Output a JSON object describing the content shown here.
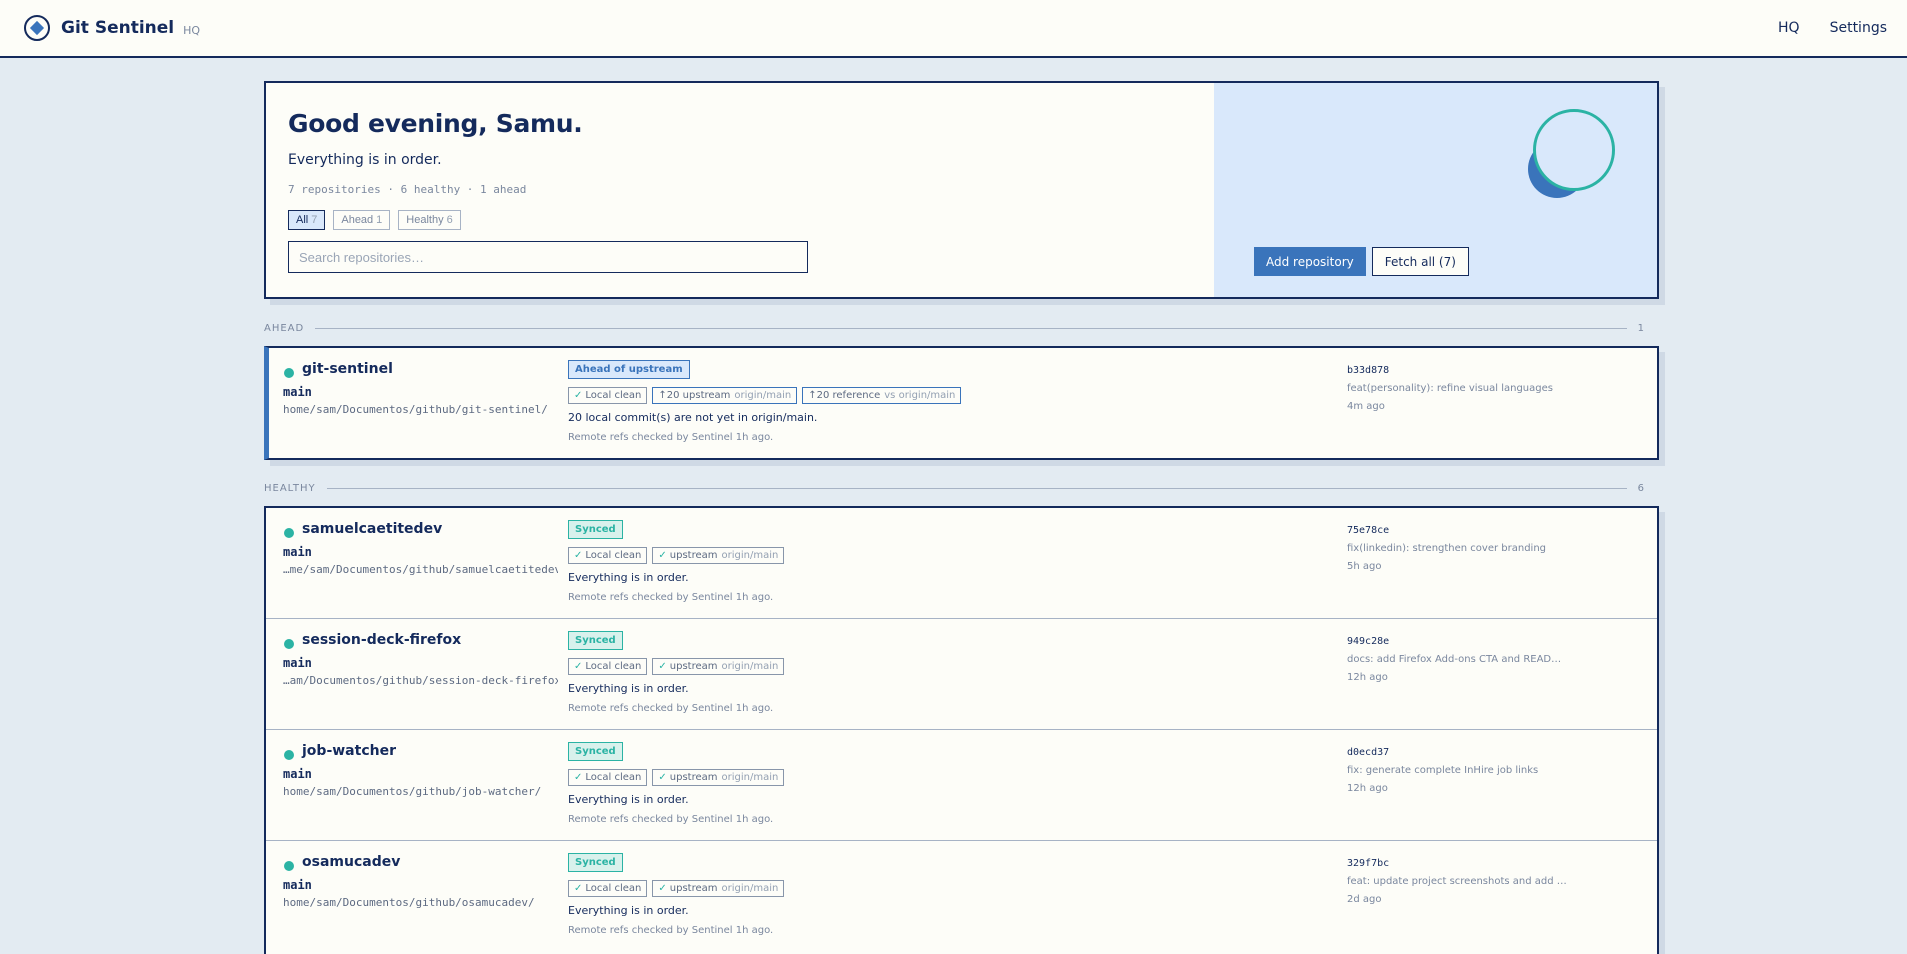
{
  "app": {
    "brand": "Git Sentinel",
    "brand_sub": "HQ"
  },
  "nav": {
    "hq": "HQ",
    "settings": "Settings"
  },
  "hero": {
    "greeting": "Good evening, Samu.",
    "status": "Everything is in order.",
    "summary": "7 repositories · 6 healthy · 1 ahead",
    "filters": [
      {
        "label": "All",
        "count": "7",
        "active": true
      },
      {
        "label": "Ahead",
        "count": "1",
        "active": false
      },
      {
        "label": "Healthy",
        "count": "6",
        "active": false
      }
    ],
    "search_placeholder": "Search repositories…",
    "add_button": "Add repository",
    "fetch_button": "Fetch all (7)"
  },
  "sections": {
    "ahead": {
      "title": "AHEAD",
      "count": "1"
    },
    "healthy": {
      "title": "HEALTHY",
      "count": "6"
    }
  },
  "ahead_repo": {
    "name": "git-sentinel",
    "branch": "main",
    "path": "home/sam/Documentos/github/git-sentinel/",
    "badge": "Ahead of upstream",
    "chip_local": "Local clean",
    "chip_upstream": "↑20 upstream",
    "chip_upstream_ref": "origin/main",
    "chip_reference": "↑20 reference",
    "chip_reference_ref": "vs origin/main",
    "message": "20 local commit(s) are not yet in origin/main.",
    "checked": "Remote refs checked by Sentinel 1h ago.",
    "sha": "b33d878",
    "commit": "feat(personality): refine visual languages",
    "age": "4m ago"
  },
  "healthy_repos": [
    {
      "name": "samuelcaetitedev",
      "branch": "main",
      "path": "…me/sam/Documentos/github/samuelcaetitedev/",
      "badge": "Synced",
      "chip_local": "Local clean",
      "chip_upstream": "upstream",
      "chip_upstream_ref": "origin/main",
      "message": "Everything is in order.",
      "checked": "Remote refs checked by Sentinel 1h ago.",
      "sha": "75e78ce",
      "commit": "fix(linkedin): strengthen cover branding",
      "age": "5h ago"
    },
    {
      "name": "session-deck-firefox",
      "branch": "main",
      "path": "…am/Documentos/github/session-deck-firefox/",
      "badge": "Synced",
      "chip_local": "Local clean",
      "chip_upstream": "upstream",
      "chip_upstream_ref": "origin/main",
      "message": "Everything is in order.",
      "checked": "Remote refs checked by Sentinel 1h ago.",
      "sha": "949c28e",
      "commit": "docs: add Firefox Add-ons CTA and READ…",
      "age": "12h ago"
    },
    {
      "name": "job-watcher",
      "branch": "main",
      "path": "home/sam/Documentos/github/job-watcher/",
      "badge": "Synced",
      "chip_local": "Local clean",
      "chip_upstream": "upstream",
      "chip_upstream_ref": "origin/main",
      "message": "Everything is in order.",
      "checked": "Remote refs checked by Sentinel 1h ago.",
      "sha": "d0ecd37",
      "commit": "fix: generate complete InHire job links",
      "age": "12h ago"
    },
    {
      "name": "osamucadev",
      "branch": "main",
      "path": "home/sam/Documentos/github/osamucadev/",
      "badge": "Synced",
      "chip_local": "Local clean",
      "chip_upstream": "upstream",
      "chip_upstream_ref": "origin/main",
      "message": "Everything is in order.",
      "checked": "Remote refs checked by Sentinel 1h ago.",
      "sha": "329f7bc",
      "commit": "feat: update project screenshots and add …",
      "age": "2d ago"
    }
  ],
  "colors": {
    "ink": "#142a5c",
    "accent": "#3a74bb",
    "ok": "#2bb3a4",
    "panel": "#d9e8fb"
  }
}
